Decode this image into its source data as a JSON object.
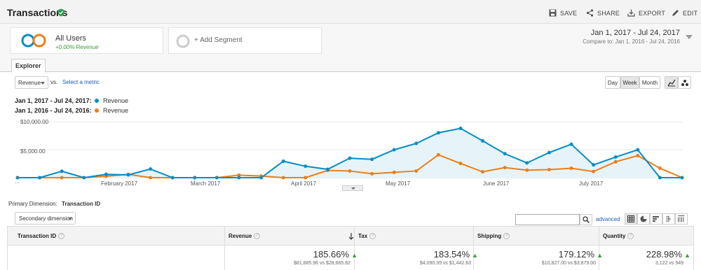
{
  "header": {
    "title": "Transactions",
    "actions": {
      "save": "SAVE",
      "share": "SHARE",
      "export": "EXPORT",
      "edit": "EDIT"
    }
  },
  "segments": {
    "all_users": {
      "label": "All Users",
      "sub": "+0.00% Revenue"
    },
    "add_segment": "+ Add Segment"
  },
  "date": {
    "range": "Jan 1, 2017 - Jul 24, 2017",
    "compare_prefix": "Compare to:",
    "compare_range": "Jan 1, 2016 - Jul 24, 2016"
  },
  "tabs": {
    "explorer": "Explorer"
  },
  "controls": {
    "metric": "Revenue",
    "vs": "vs.",
    "select_metric": "Select a metric",
    "day": "Day",
    "week": "Week",
    "month": "Month"
  },
  "legend": [
    {
      "period": "Jan 1, 2017 - Jul 24, 2017:",
      "series": "Revenue",
      "color": "#058dc7"
    },
    {
      "period": "Jan 1, 2016 - Jul 24, 2016:",
      "series": "Revenue",
      "color": "#ed7e17"
    }
  ],
  "chart_data": {
    "type": "line",
    "y_tick_labels": [
      "$10,000.00",
      "$5,000.00"
    ],
    "x_tick_labels": [
      "...",
      "February 2017",
      "March 2017",
      "April 2017",
      "May 2017",
      "June 2017",
      "July 2017"
    ],
    "ylim": [
      0,
      11800
    ],
    "series": [
      {
        "name": "Revenue",
        "period": "2017",
        "color": "#058dc7",
        "values": [
          0,
          0,
          1150,
          0,
          600,
          500,
          1550,
          0,
          0,
          0,
          0,
          0,
          2950,
          2050,
          1500,
          3500,
          3300,
          5000,
          6150,
          8050,
          8850,
          6600,
          4300,
          2650,
          4500,
          6000,
          2300,
          3700,
          5000,
          0,
          0
        ]
      },
      {
        "name": "Revenue",
        "period": "2016",
        "color": "#ed7e17",
        "values": [
          0,
          0,
          0,
          0,
          250,
          600,
          0,
          0,
          0,
          0,
          450,
          300,
          0,
          0,
          1300,
          1200,
          700,
          950,
          1200,
          4100,
          2550,
          1050,
          1800,
          1350,
          1450,
          1700,
          1100,
          2850,
          3950,
          1700,
          0
        ]
      }
    ]
  },
  "dimension": {
    "primary_label": "Primary Dimension:",
    "primary_value": "Transaction ID",
    "secondary": "Secondary dimension",
    "advanced": "advanced"
  },
  "table": {
    "columns": [
      "Transaction ID",
      "Revenue",
      "Tax",
      "Shipping",
      "Quantity"
    ],
    "totals": [
      {
        "pct": "185.66%",
        "cmp": "$81,885.96 vs $28,665.82"
      },
      {
        "pct": "183.54%",
        "cmp": "$4,090.39 vs $1,442.63"
      },
      {
        "pct": "179.12%",
        "cmp": "$10,827.00 vs $3,879.00"
      },
      {
        "pct": "228.98%",
        "cmp": "3,122 vs 949"
      }
    ]
  },
  "colors": {
    "blue": "#058dc7",
    "orange": "#ed7e17",
    "green": "#3a9b3a"
  }
}
